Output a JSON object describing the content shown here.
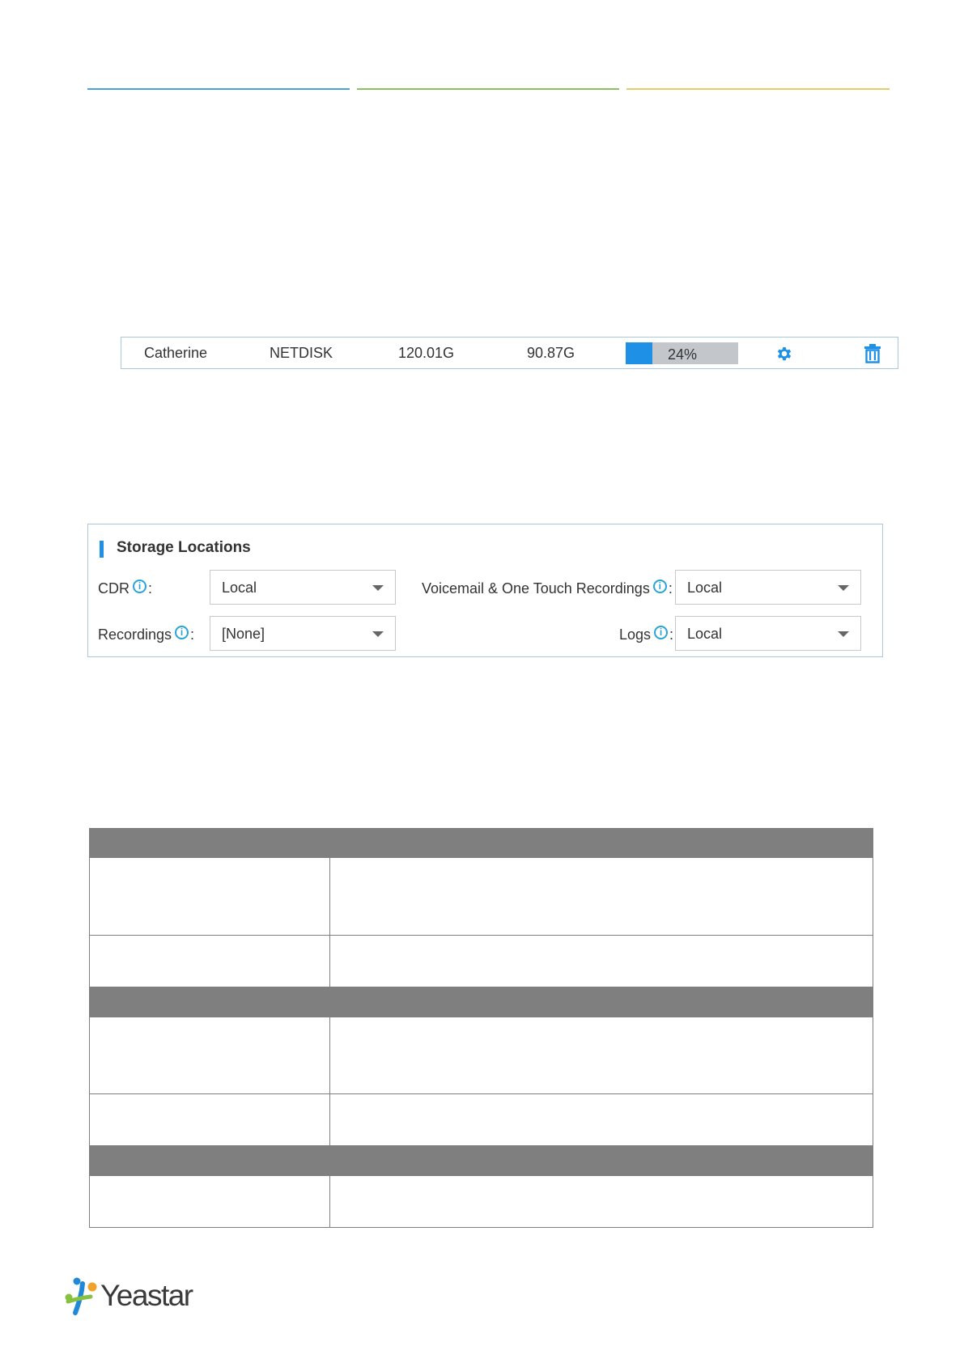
{
  "colors": {
    "divider_blue": "#4aa3d6",
    "divider_green": "#8dc063",
    "divider_yellow": "#e1cc6a",
    "accent": "#1e90e6",
    "info_icon": "#29a3dc",
    "table_header": "#7f7f7f",
    "logo_blue": "#1f89d8",
    "logo_green": "#86c13f",
    "logo_orange": "#f0a22a"
  },
  "netdisk_row": {
    "name": "Catherine",
    "type": "NETDISK",
    "total": "120.01G",
    "free": "90.87G",
    "usage_label": "24%",
    "usage_fraction": 0.24,
    "settings_icon": "gear-icon",
    "delete_icon": "trash-icon"
  },
  "storage_locations": {
    "title": "Storage Locations",
    "cdr": {
      "label": "CDR",
      "value": "Local"
    },
    "recordings": {
      "label": "Recordings",
      "value": "[None]"
    },
    "voicemail": {
      "label": "Voicemail & One Touch Recordings",
      "value": "Local"
    },
    "logs": {
      "label": "Logs",
      "value": "Local"
    },
    "info_icon": "info-icon",
    "colon": ":"
  },
  "logo": {
    "text": "Yeastar"
  }
}
